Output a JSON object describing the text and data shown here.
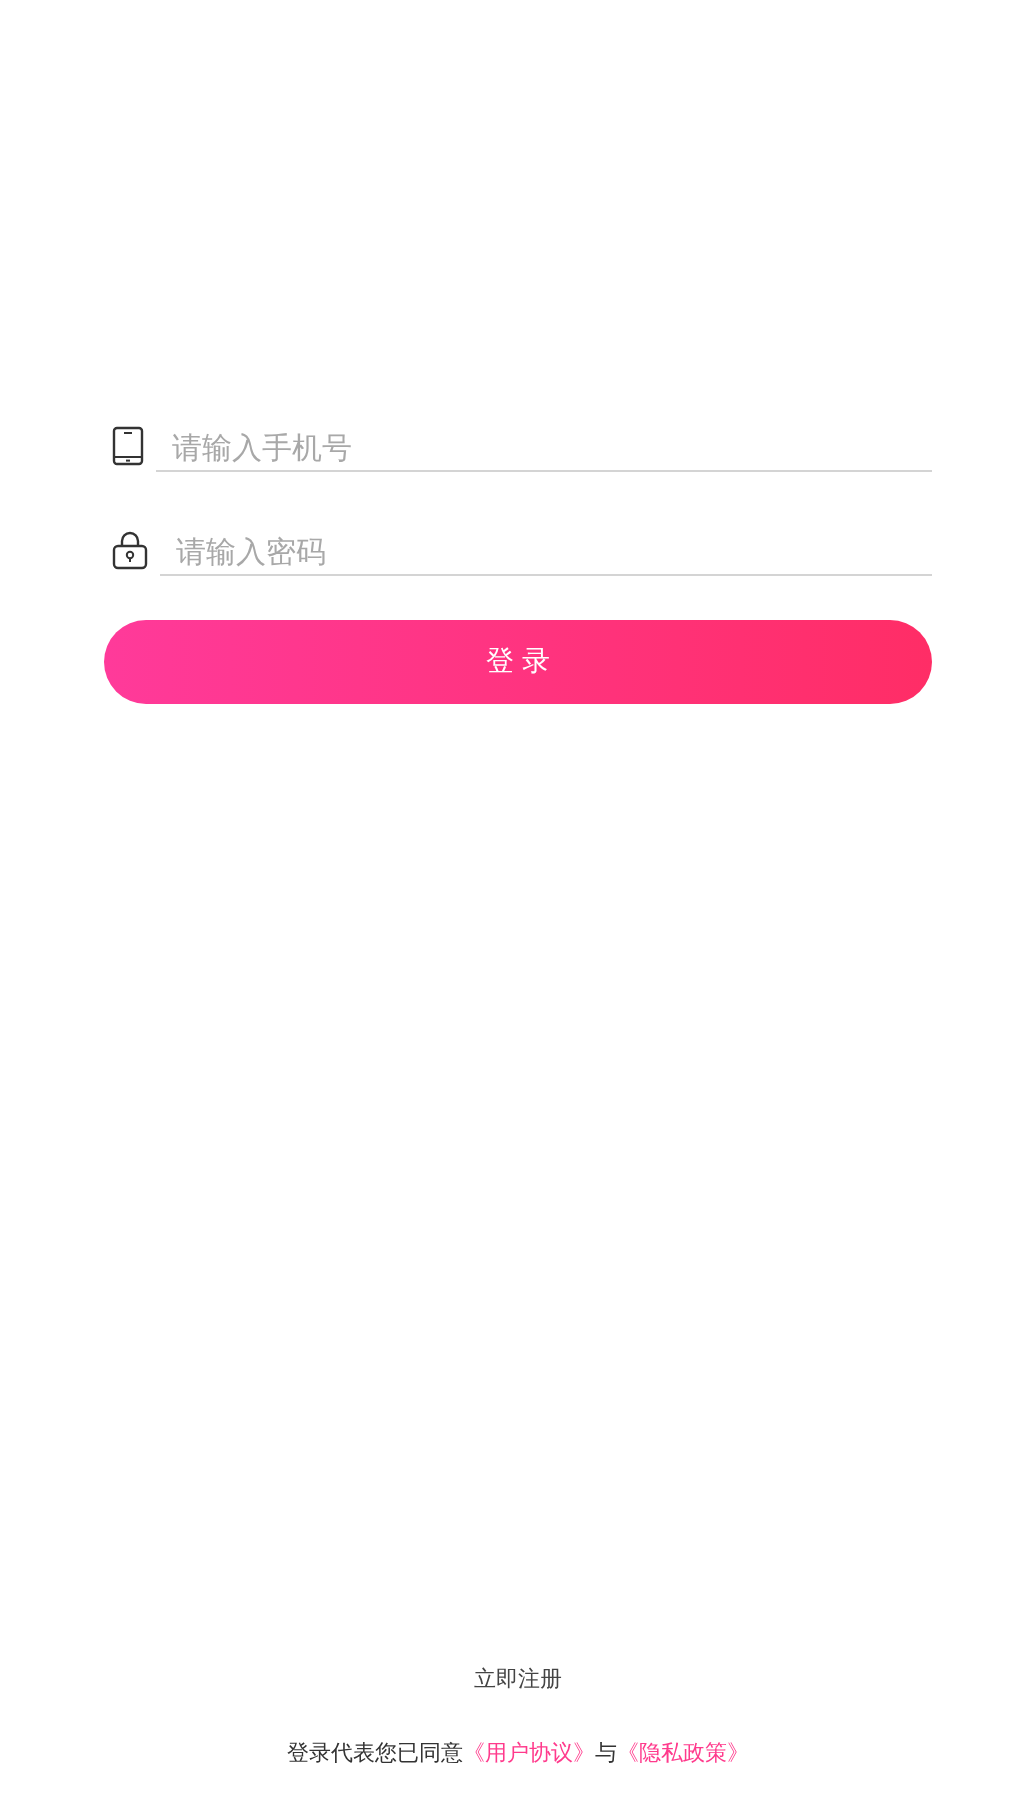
{
  "phone_field": {
    "placeholder": "请输入手机号"
  },
  "password_field": {
    "placeholder": "请输入密码"
  },
  "login_button": {
    "label": "登 录"
  },
  "register_link": "立即注册",
  "agreement": {
    "text": "登录代表您已同意",
    "links": [
      "《用户协议》",
      "《隐私政策》"
    ],
    "joiner": "与"
  }
}
